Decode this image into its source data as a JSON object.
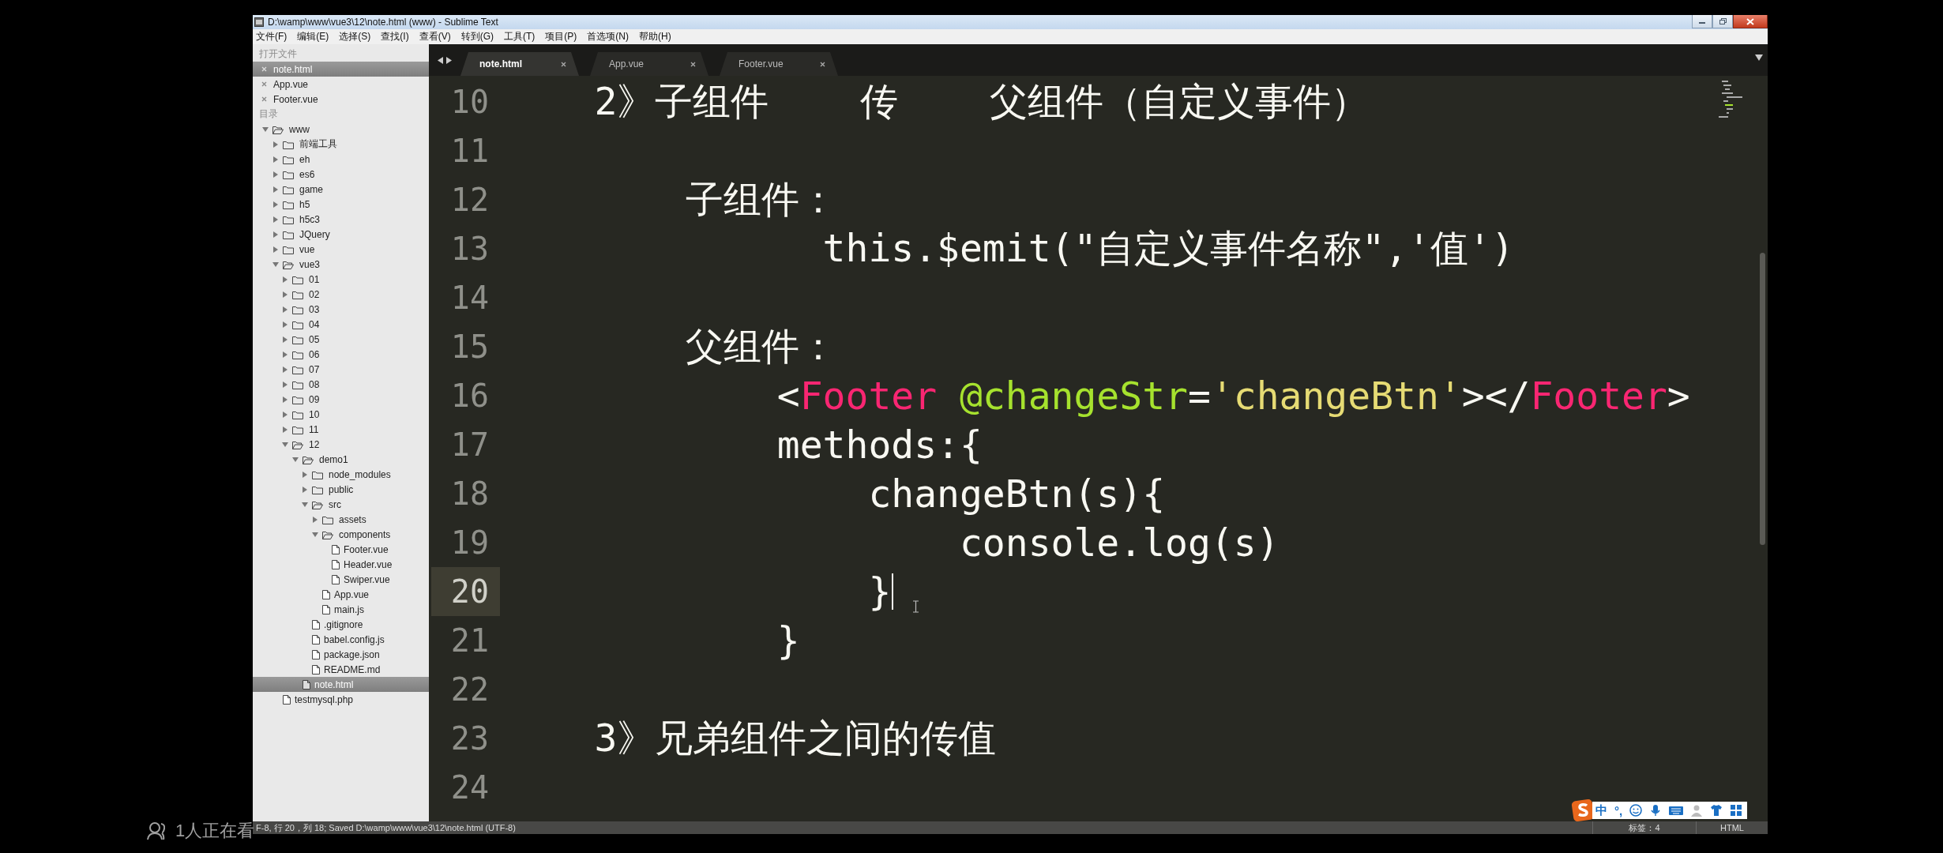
{
  "window": {
    "title": "D:\\wamp\\www\\vue3\\12\\note.html (www) - Sublime Text"
  },
  "menu": [
    "文件(F)",
    "编辑(E)",
    "选择(S)",
    "查找(I)",
    "查看(V)",
    "转到(G)",
    "工具(T)",
    "项目(P)",
    "首选项(N)",
    "帮助(H)"
  ],
  "sidebar": {
    "open_files_heading": "打开文件",
    "open_files": [
      {
        "name": "note.html",
        "selected": true
      },
      {
        "name": "App.vue",
        "selected": false
      },
      {
        "name": "Footer.vue",
        "selected": false
      }
    ],
    "folders_heading": "目录",
    "tree": [
      {
        "name": "www",
        "kind": "folder",
        "expanded": true,
        "selected": false,
        "children": [
          {
            "name": "前端工具",
            "kind": "folder",
            "expanded": false,
            "selected": false
          },
          {
            "name": "eh",
            "kind": "folder",
            "expanded": false,
            "selected": false
          },
          {
            "name": "es6",
            "kind": "folder",
            "expanded": false,
            "selected": false
          },
          {
            "name": "game",
            "kind": "folder",
            "expanded": false,
            "selected": false
          },
          {
            "name": "h5",
            "kind": "folder",
            "expanded": false,
            "selected": false
          },
          {
            "name": "h5c3",
            "kind": "folder",
            "expanded": false,
            "selected": false
          },
          {
            "name": "JQuery",
            "kind": "folder",
            "expanded": false,
            "selected": false
          },
          {
            "name": "vue",
            "kind": "folder",
            "expanded": false,
            "selected": false
          },
          {
            "name": "vue3",
            "kind": "folder",
            "expanded": true,
            "selected": false,
            "children": [
              {
                "name": "01",
                "kind": "folder",
                "expanded": false,
                "selected": false
              },
              {
                "name": "02",
                "kind": "folder",
                "expanded": false,
                "selected": false
              },
              {
                "name": "03",
                "kind": "folder",
                "expanded": false,
                "selected": false
              },
              {
                "name": "04",
                "kind": "folder",
                "expanded": false,
                "selected": false
              },
              {
                "name": "05",
                "kind": "folder",
                "expanded": false,
                "selected": false
              },
              {
                "name": "06",
                "kind": "folder",
                "expanded": false,
                "selected": false
              },
              {
                "name": "07",
                "kind": "folder",
                "expanded": false,
                "selected": false
              },
              {
                "name": "08",
                "kind": "folder",
                "expanded": false,
                "selected": false
              },
              {
                "name": "09",
                "kind": "folder",
                "expanded": false,
                "selected": false
              },
              {
                "name": "10",
                "kind": "folder",
                "expanded": false,
                "selected": false
              },
              {
                "name": "11",
                "kind": "folder",
                "expanded": false,
                "selected": false
              },
              {
                "name": "12",
                "kind": "folder",
                "expanded": true,
                "selected": false,
                "children": [
                  {
                    "name": "demo1",
                    "kind": "folder",
                    "expanded": true,
                    "selected": false,
                    "children": [
                      {
                        "name": "node_modules",
                        "kind": "folder",
                        "expanded": false,
                        "selected": false
                      },
                      {
                        "name": "public",
                        "kind": "folder",
                        "expanded": false,
                        "selected": false
                      },
                      {
                        "name": "src",
                        "kind": "folder",
                        "expanded": true,
                        "selected": false,
                        "children": [
                          {
                            "name": "assets",
                            "kind": "folder",
                            "expanded": false,
                            "selected": false
                          },
                          {
                            "name": "components",
                            "kind": "folder",
                            "expanded": true,
                            "selected": false,
                            "children": [
                              {
                                "name": "Footer.vue",
                                "kind": "file",
                                "selected": false
                              },
                              {
                                "name": "Header.vue",
                                "kind": "file",
                                "selected": false
                              },
                              {
                                "name": "Swiper.vue",
                                "kind": "file",
                                "selected": false
                              }
                            ]
                          },
                          {
                            "name": "App.vue",
                            "kind": "file",
                            "selected": false
                          },
                          {
                            "name": "main.js",
                            "kind": "file",
                            "selected": false
                          }
                        ]
                      },
                      {
                        "name": ".gitignore",
                        "kind": "file",
                        "selected": false
                      },
                      {
                        "name": "babel.config.js",
                        "kind": "file",
                        "selected": false
                      },
                      {
                        "name": "package.json",
                        "kind": "file",
                        "selected": false
                      },
                      {
                        "name": "README.md",
                        "kind": "file",
                        "selected": false
                      }
                    ]
                  },
                  {
                    "name": "note.html",
                    "kind": "file",
                    "selected": true
                  }
                ]
              }
            ]
          },
          {
            "name": "testmysql.php",
            "kind": "file",
            "selected": false
          }
        ]
      }
    ]
  },
  "tabs": [
    {
      "label": "note.html",
      "selected": true
    },
    {
      "label": "App.vue",
      "selected": false
    },
    {
      "label": "Footer.vue",
      "selected": false
    }
  ],
  "lines": [
    {
      "number": "10",
      "current": false,
      "tokens": [
        {
          "kind": "text",
          "text": "    2》子组件    传    父组件（自定义事件）"
        }
      ]
    },
    {
      "number": "11",
      "current": false
    },
    {
      "number": "12",
      "current": false,
      "tokens": [
        {
          "kind": "text",
          "text": "        子组件："
        }
      ]
    },
    {
      "number": "13",
      "current": false,
      "tokens": [
        {
          "kind": "text",
          "text": "              this.$emit(\"自定义事件名称\",'值')"
        }
      ]
    },
    {
      "number": "14",
      "current": false
    },
    {
      "number": "15",
      "current": false,
      "tokens": [
        {
          "kind": "text",
          "text": "        父组件："
        }
      ]
    },
    {
      "number": "16",
      "current": false,
      "tokens": [
        {
          "kind": "text",
          "text": "            <"
        },
        {
          "kind": "tag",
          "text": "Footer"
        },
        {
          "kind": "attr",
          "text": " @changeStr"
        },
        {
          "kind": "text",
          "text": "="
        },
        {
          "kind": "string",
          "text": "'changeBtn'"
        },
        {
          "kind": "text",
          "text": "></"
        },
        {
          "kind": "tag",
          "text": "Footer"
        },
        {
          "kind": "text",
          "text": ">"
        }
      ]
    },
    {
      "number": "17",
      "current": false,
      "tokens": [
        {
          "kind": "text",
          "text": "            methods:{"
        }
      ]
    },
    {
      "number": "18",
      "current": false,
      "tokens": [
        {
          "kind": "text",
          "text": "                changeBtn(s){"
        }
      ]
    },
    {
      "number": "19",
      "current": false,
      "tokens": [
        {
          "kind": "text",
          "text": "                    console.log(s)"
        }
      ]
    },
    {
      "number": "20",
      "current": true,
      "tokens": [
        {
          "kind": "text",
          "text": "                }"
        }
      ]
    },
    {
      "number": "21",
      "current": false,
      "tokens": [
        {
          "kind": "text",
          "text": "            }"
        }
      ]
    },
    {
      "number": "22",
      "current": false
    },
    {
      "number": "23",
      "current": false,
      "tokens": [
        {
          "kind": "text",
          "text": "    3》兄弟组件之间的传值"
        }
      ]
    },
    {
      "number": "24",
      "current": false
    }
  ],
  "status_bar": {
    "message": "F-8, 行 20，列 18; Saved D:\\wamp\\www\\vue3\\12\\note.html (UTF-8)",
    "indentation": "标签：4",
    "syntax": "HTML"
  },
  "ime_bar": {
    "mode": "中",
    "punctuation": "°,"
  },
  "viewer_overlay": {
    "text": "1人正在看"
  }
}
